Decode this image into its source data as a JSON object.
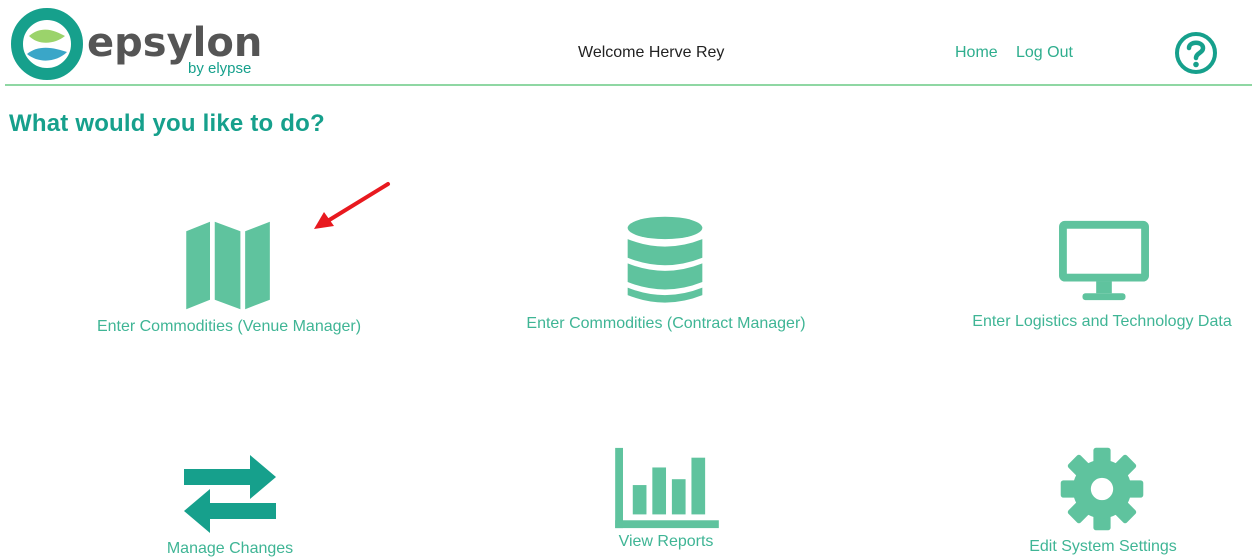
{
  "header": {
    "logo_name": "epsylon",
    "logo_tagline": "by elypse",
    "welcome": "Welcome Herve Rey",
    "home_label": "Home",
    "logout_label": "Log Out",
    "help_icon": "question-circle-icon"
  },
  "main": {
    "title": "What would you like to do?",
    "tiles": [
      {
        "label": "Enter Commodities (Venue Manager)",
        "icon": "map-icon"
      },
      {
        "label": "Enter Commodities (Contract Manager)",
        "icon": "database-icon"
      },
      {
        "label": "Enter Logistics and Technology Data",
        "icon": "monitor-icon"
      },
      {
        "label": "Manage Changes",
        "icon": "exchange-arrows-icon"
      },
      {
        "label": "View Reports",
        "icon": "bar-chart-icon"
      },
      {
        "label": "Edit System Settings",
        "icon": "gear-icon"
      }
    ]
  },
  "colors": {
    "brand_teal": "#16a08c",
    "icon_green": "#5fc39e",
    "link_green": "#2fae8e",
    "header_line": "#8fd7a3",
    "annotation_red": "#e8191f"
  }
}
